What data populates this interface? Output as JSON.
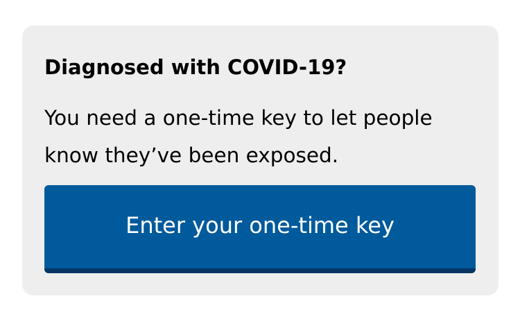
{
  "card": {
    "title": "Diagnosed with COVID-19?",
    "body": "You need a one-time key to let people know they’ve been exposed.",
    "button_label": "Enter your one-time key"
  },
  "colors": {
    "card_background": "#eeeeee",
    "button_background": "#005a9c",
    "button_shadow": "#053664",
    "button_text": "#ffffff",
    "text": "#000000"
  }
}
